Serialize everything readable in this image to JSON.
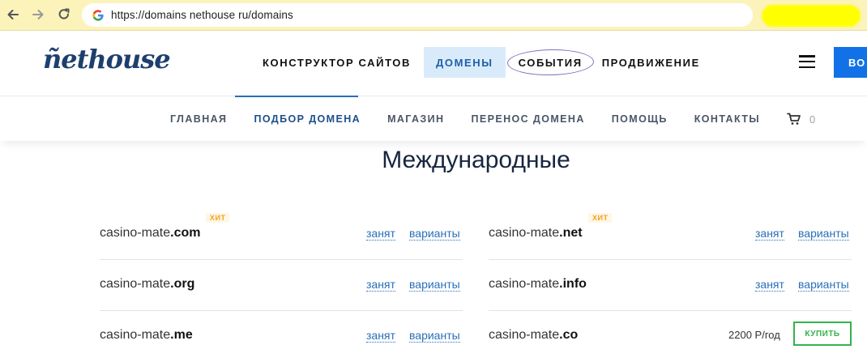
{
  "browser": {
    "url": "https://domains nethouse ru/domains"
  },
  "header": {
    "logo": "ñethouse",
    "nav": [
      "КОНСТРУКТОР САЙТОВ",
      "ДОМЕНЫ",
      "СОБЫТИЯ",
      "ПРОДВИЖЕНИЕ"
    ],
    "cta_label": "ВО"
  },
  "subnav": {
    "items": [
      "ГЛАВНАЯ",
      "ПОДБОР ДОМЕНА",
      "МАГАЗИН",
      "ПЕРЕНОС ДОМЕНА",
      "ПОМОЩЬ",
      "КОНТАКТЫ"
    ],
    "cart_count": "0"
  },
  "section_title": "Международные",
  "labels": {
    "hit": "ХИТ",
    "taken": "занят",
    "variants": "варианты",
    "buy": "КУПИТЬ"
  },
  "domains": {
    "left": [
      {
        "base": "casino-mate",
        "zone": ".com",
        "status": "занят",
        "variants": "варианты"
      },
      {
        "base": "casino-mate",
        "zone": ".org",
        "status": "занят",
        "variants": "варианты"
      },
      {
        "base": "casino-mate",
        "zone": ".me",
        "status": "занят",
        "variants": "варианты"
      }
    ],
    "right": [
      {
        "base": "casino-mate",
        "zone": ".net",
        "status": "занят",
        "variants": "варианты"
      },
      {
        "base": "casino-mate",
        "zone": ".info",
        "status": "занят",
        "variants": "варианты"
      },
      {
        "base": "casino-mate",
        "zone": ".co",
        "price": "2200 Р/год",
        "buy": "КУПИТЬ"
      }
    ]
  },
  "colors": {
    "brand": "#1e3f6e",
    "link": "#2a6fb8",
    "accent_blue": "#1371e8",
    "buy_green": "#34b24a",
    "hit_orange": "#f2a31d",
    "browser_bar": "#fbf3b9"
  }
}
